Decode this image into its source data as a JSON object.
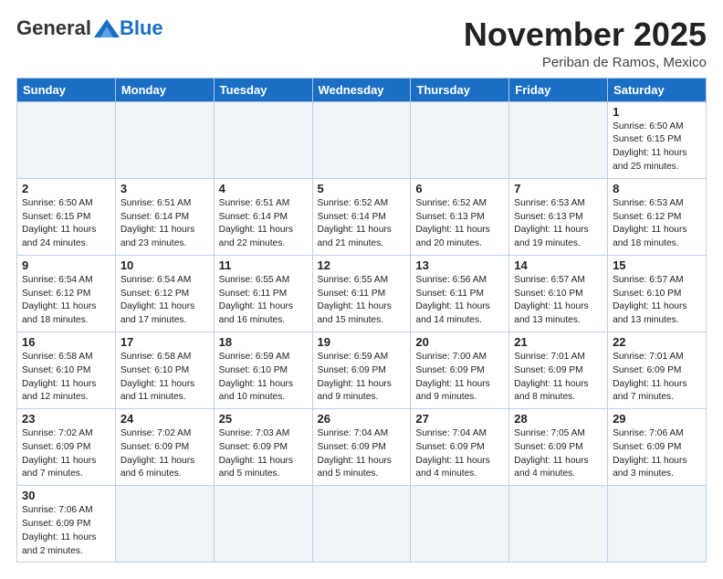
{
  "logo": {
    "general": "General",
    "blue": "Blue"
  },
  "title": "November 2025",
  "location": "Periban de Ramos, Mexico",
  "weekdays": [
    "Sunday",
    "Monday",
    "Tuesday",
    "Wednesday",
    "Thursday",
    "Friday",
    "Saturday"
  ],
  "weeks": [
    [
      {
        "day": "",
        "info": ""
      },
      {
        "day": "",
        "info": ""
      },
      {
        "day": "",
        "info": ""
      },
      {
        "day": "",
        "info": ""
      },
      {
        "day": "",
        "info": ""
      },
      {
        "day": "",
        "info": ""
      },
      {
        "day": "1",
        "info": "Sunrise: 6:50 AM\nSunset: 6:15 PM\nDaylight: 11 hours\nand 25 minutes."
      }
    ],
    [
      {
        "day": "2",
        "info": "Sunrise: 6:50 AM\nSunset: 6:15 PM\nDaylight: 11 hours\nand 24 minutes."
      },
      {
        "day": "3",
        "info": "Sunrise: 6:51 AM\nSunset: 6:14 PM\nDaylight: 11 hours\nand 23 minutes."
      },
      {
        "day": "4",
        "info": "Sunrise: 6:51 AM\nSunset: 6:14 PM\nDaylight: 11 hours\nand 22 minutes."
      },
      {
        "day": "5",
        "info": "Sunrise: 6:52 AM\nSunset: 6:14 PM\nDaylight: 11 hours\nand 21 minutes."
      },
      {
        "day": "6",
        "info": "Sunrise: 6:52 AM\nSunset: 6:13 PM\nDaylight: 11 hours\nand 20 minutes."
      },
      {
        "day": "7",
        "info": "Sunrise: 6:53 AM\nSunset: 6:13 PM\nDaylight: 11 hours\nand 19 minutes."
      },
      {
        "day": "8",
        "info": "Sunrise: 6:53 AM\nSunset: 6:12 PM\nDaylight: 11 hours\nand 18 minutes."
      }
    ],
    [
      {
        "day": "9",
        "info": "Sunrise: 6:54 AM\nSunset: 6:12 PM\nDaylight: 11 hours\nand 18 minutes."
      },
      {
        "day": "10",
        "info": "Sunrise: 6:54 AM\nSunset: 6:12 PM\nDaylight: 11 hours\nand 17 minutes."
      },
      {
        "day": "11",
        "info": "Sunrise: 6:55 AM\nSunset: 6:11 PM\nDaylight: 11 hours\nand 16 minutes."
      },
      {
        "day": "12",
        "info": "Sunrise: 6:55 AM\nSunset: 6:11 PM\nDaylight: 11 hours\nand 15 minutes."
      },
      {
        "day": "13",
        "info": "Sunrise: 6:56 AM\nSunset: 6:11 PM\nDaylight: 11 hours\nand 14 minutes."
      },
      {
        "day": "14",
        "info": "Sunrise: 6:57 AM\nSunset: 6:10 PM\nDaylight: 11 hours\nand 13 minutes."
      },
      {
        "day": "15",
        "info": "Sunrise: 6:57 AM\nSunset: 6:10 PM\nDaylight: 11 hours\nand 13 minutes."
      }
    ],
    [
      {
        "day": "16",
        "info": "Sunrise: 6:58 AM\nSunset: 6:10 PM\nDaylight: 11 hours\nand 12 minutes."
      },
      {
        "day": "17",
        "info": "Sunrise: 6:58 AM\nSunset: 6:10 PM\nDaylight: 11 hours\nand 11 minutes."
      },
      {
        "day": "18",
        "info": "Sunrise: 6:59 AM\nSunset: 6:10 PM\nDaylight: 11 hours\nand 10 minutes."
      },
      {
        "day": "19",
        "info": "Sunrise: 6:59 AM\nSunset: 6:09 PM\nDaylight: 11 hours\nand 9 minutes."
      },
      {
        "day": "20",
        "info": "Sunrise: 7:00 AM\nSunset: 6:09 PM\nDaylight: 11 hours\nand 9 minutes."
      },
      {
        "day": "21",
        "info": "Sunrise: 7:01 AM\nSunset: 6:09 PM\nDaylight: 11 hours\nand 8 minutes."
      },
      {
        "day": "22",
        "info": "Sunrise: 7:01 AM\nSunset: 6:09 PM\nDaylight: 11 hours\nand 7 minutes."
      }
    ],
    [
      {
        "day": "23",
        "info": "Sunrise: 7:02 AM\nSunset: 6:09 PM\nDaylight: 11 hours\nand 7 minutes."
      },
      {
        "day": "24",
        "info": "Sunrise: 7:02 AM\nSunset: 6:09 PM\nDaylight: 11 hours\nand 6 minutes."
      },
      {
        "day": "25",
        "info": "Sunrise: 7:03 AM\nSunset: 6:09 PM\nDaylight: 11 hours\nand 5 minutes."
      },
      {
        "day": "26",
        "info": "Sunrise: 7:04 AM\nSunset: 6:09 PM\nDaylight: 11 hours\nand 5 minutes."
      },
      {
        "day": "27",
        "info": "Sunrise: 7:04 AM\nSunset: 6:09 PM\nDaylight: 11 hours\nand 4 minutes."
      },
      {
        "day": "28",
        "info": "Sunrise: 7:05 AM\nSunset: 6:09 PM\nDaylight: 11 hours\nand 4 minutes."
      },
      {
        "day": "29",
        "info": "Sunrise: 7:06 AM\nSunset: 6:09 PM\nDaylight: 11 hours\nand 3 minutes."
      }
    ],
    [
      {
        "day": "30",
        "info": "Sunrise: 7:06 AM\nSunset: 6:09 PM\nDaylight: 11 hours\nand 2 minutes."
      },
      {
        "day": "",
        "info": ""
      },
      {
        "day": "",
        "info": ""
      },
      {
        "day": "",
        "info": ""
      },
      {
        "day": "",
        "info": ""
      },
      {
        "day": "",
        "info": ""
      },
      {
        "day": "",
        "info": ""
      }
    ]
  ]
}
